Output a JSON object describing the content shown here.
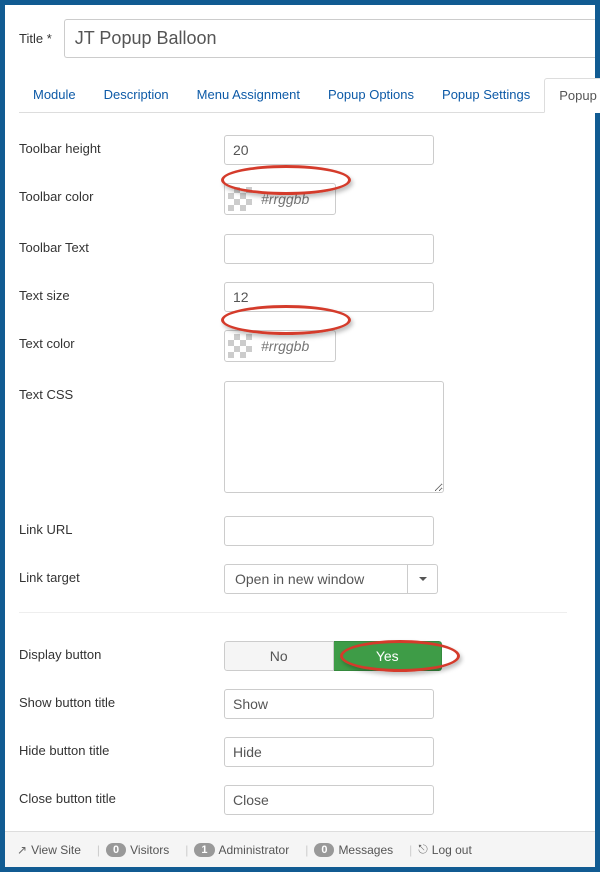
{
  "title": {
    "label": "Title *",
    "value": "JT Popup Balloon"
  },
  "tabs": [
    "Module",
    "Description",
    "Menu Assignment",
    "Popup Options",
    "Popup Settings",
    "Popup"
  ],
  "active_tab": 5,
  "fields": {
    "toolbar_height": {
      "label": "Toolbar height",
      "value": "20"
    },
    "toolbar_color": {
      "label": "Toolbar color",
      "placeholder": "#rrggbb"
    },
    "toolbar_text": {
      "label": "Toolbar Text",
      "value": ""
    },
    "text_size": {
      "label": "Text size",
      "value": "12"
    },
    "text_color": {
      "label": "Text color",
      "placeholder": "#rrggbb"
    },
    "text_css": {
      "label": "Text CSS",
      "value": ""
    },
    "link_url": {
      "label": "Link URL",
      "value": ""
    },
    "link_target": {
      "label": "Link target",
      "value": "Open in new window"
    },
    "display_button": {
      "label": "Display button",
      "no": "No",
      "yes": "Yes"
    },
    "show_title": {
      "label": "Show button title",
      "value": "Show"
    },
    "hide_title": {
      "label": "Hide button title",
      "value": "Hide"
    },
    "close_title": {
      "label": "Close button title",
      "value": "Close"
    }
  },
  "footer": {
    "view_site": "View Site",
    "visitors_count": "0",
    "visitors": "Visitors",
    "admin_count": "1",
    "admin": "Administrator",
    "msg_count": "0",
    "msg": "Messages",
    "logout": "Log out"
  }
}
